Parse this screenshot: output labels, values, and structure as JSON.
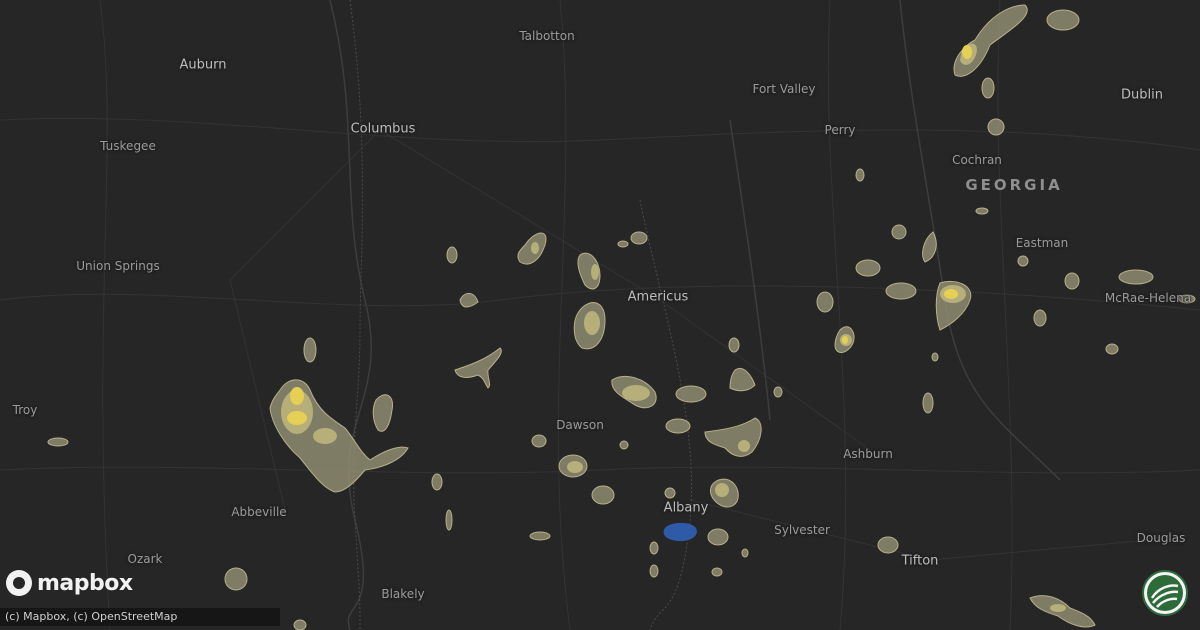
{
  "map": {
    "cities": [
      {
        "name": "Talbotton",
        "big": false
      },
      {
        "name": "Auburn",
        "big": true
      },
      {
        "name": "Columbus",
        "big": true
      },
      {
        "name": "Fort Valley",
        "big": false
      },
      {
        "name": "Dublin",
        "big": true
      },
      {
        "name": "Tuskegee",
        "big": false
      },
      {
        "name": "Perry",
        "big": false
      },
      {
        "name": "Cochran",
        "big": false
      },
      {
        "name": "Eastman",
        "big": false
      },
      {
        "name": "Union Springs",
        "big": false
      },
      {
        "name": "Americus",
        "big": true
      },
      {
        "name": "McRae-Helena",
        "big": false
      },
      {
        "name": "Troy",
        "big": false
      },
      {
        "name": "Dawson",
        "big": false
      },
      {
        "name": "Ashburn",
        "big": false
      },
      {
        "name": "Abbeville",
        "big": false
      },
      {
        "name": "Albany",
        "big": true
      },
      {
        "name": "Sylvester",
        "big": false
      },
      {
        "name": "Douglas",
        "big": false
      },
      {
        "name": "Ozark",
        "big": false
      },
      {
        "name": "Tifton",
        "big": true
      },
      {
        "name": "Blakely",
        "big": false
      }
    ],
    "state_label": "GEORGIA",
    "colors": {
      "background": "#262626",
      "hail_light": "#8f8c72",
      "hail_mid": "#b9b17a",
      "hail_core": "#e6cf55",
      "water": "#2f5aa8"
    }
  },
  "logo": {
    "text": "mapbox",
    "icon": "mapbox-logo-icon"
  },
  "attribution": "(c) Mapbox, (c) OpenStreetMap",
  "badge": {
    "icon": "brand-badge-icon"
  }
}
